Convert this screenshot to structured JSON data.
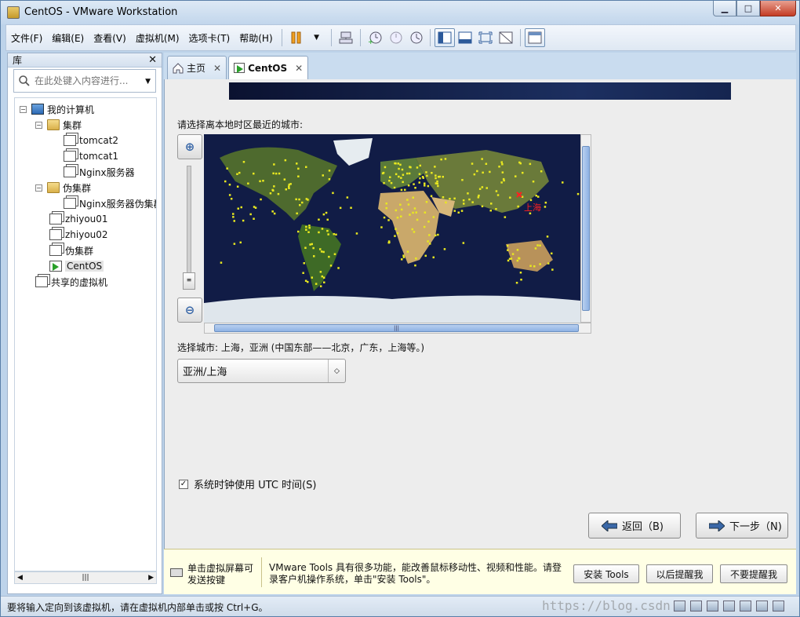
{
  "window": {
    "title": "CentOS - VMware Workstation"
  },
  "menu": [
    "文件(F)",
    "编辑(E)",
    "查看(V)",
    "虚拟机(M)",
    "选项卡(T)",
    "帮助(H)"
  ],
  "library": {
    "title": "库",
    "search_placeholder": "在此处键入内容进行...",
    "tree": [
      {
        "label": "我的计算机",
        "icon": "computer-icon"
      },
      {
        "label": "集群",
        "icon": "folder-icon"
      },
      {
        "label": "tomcat2",
        "icon": "vm-icon"
      },
      {
        "label": "tomcat1",
        "icon": "vm-icon"
      },
      {
        "label": "Nginx服务器",
        "icon": "vm-icon"
      },
      {
        "label": "伪集群",
        "icon": "folder-icon"
      },
      {
        "label": "Nginx服务器伪集群",
        "icon": "vm-icon"
      },
      {
        "label": "zhiyou01",
        "icon": "vm-icon"
      },
      {
        "label": "zhiyou02",
        "icon": "vm-icon"
      },
      {
        "label": "伪集群",
        "icon": "vm-icon"
      },
      {
        "label": "CentOS",
        "icon": "vm-running-icon"
      },
      {
        "label": "共享的虚拟机",
        "icon": "shared-vm-icon"
      }
    ]
  },
  "tabs": [
    {
      "label": "主页",
      "icon": "home-icon"
    },
    {
      "label": "CentOS",
      "icon": "vm-running-icon"
    }
  ],
  "installer": {
    "prompt": "请选择离本地时区最近的城市:",
    "map_city_label": "上海",
    "selected_city_info": "选择城市: 上海，亚洲 (中国东部——北京，广东，上海等。)",
    "timezone_select": "亚洲/上海",
    "utc_label": "系统时钟使用 UTC 时间(S)",
    "utc_checked": true,
    "back_label": "返回（B)",
    "next_label": "下一步（N)"
  },
  "notification": {
    "hint": "单击虚拟屏幕可发送按键",
    "message": "VMware Tools 具有很多功能，能改善鼠标移动性、视频和性能。请登录客户机操作系统，单击\"安装 Tools\"。",
    "install_label": "安装 Tools",
    "remind_later_label": "以后提醒我",
    "never_remind_label": "不要提醒我"
  },
  "status": {
    "text": "要将输入定向到该虚拟机，请在虚拟机内部单击或按 Ctrl+G。",
    "watermark": "https://blog.csdn"
  },
  "colors": {
    "city_marker": "#ff2020",
    "map_dots": "#e8e820",
    "accent": "#3a68a8"
  }
}
